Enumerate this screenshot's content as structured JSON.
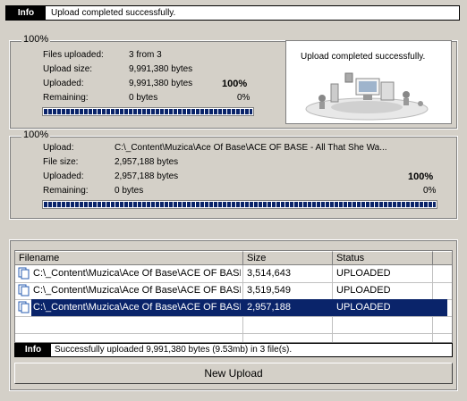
{
  "top_info": {
    "tag": "Info",
    "message": "Upload completed successfully."
  },
  "total_group": {
    "title": "100%",
    "files_uploaded_label": "Files uploaded:",
    "files_uploaded_value": "3 from 3",
    "upload_size_label": "Upload size:",
    "upload_size_value": "9,991,380 bytes",
    "uploaded_label": "Uploaded:",
    "uploaded_value": "9,991,380 bytes",
    "percent": "100%",
    "remaining_label": "Remaining:",
    "remaining_value": "0 bytes",
    "remaining_percent": "0%",
    "progress": 1.0
  },
  "status_panel": {
    "message": "Upload completed successfully."
  },
  "file_group": {
    "title": "100%",
    "upload_label": "Upload:",
    "upload_value": "C:\\_Content\\Muzica\\Ace Of Base\\ACE OF BASE - All That She Wa...",
    "file_size_label": "File size:",
    "file_size_value": "2,957,188 bytes",
    "uploaded_label": "Uploaded:",
    "uploaded_value": "2,957,188 bytes",
    "percent": "100%",
    "remaining_label": "Remaining:",
    "remaining_value": "0 bytes",
    "remaining_percent": "0%",
    "progress": 1.0
  },
  "table": {
    "columns": [
      "Filename",
      "Size",
      "Status"
    ],
    "rows": [
      {
        "filename": "C:\\_Content\\Muzica\\Ace Of Base\\ACE OF BASE ...",
        "size": "3,514,643",
        "status": "UPLOADED",
        "selected": false
      },
      {
        "filename": "C:\\_Content\\Muzica\\Ace Of Base\\ACE OF BASE ...",
        "size": "3,519,549",
        "status": "UPLOADED",
        "selected": false
      },
      {
        "filename": "C:\\_Content\\Muzica\\Ace Of Base\\ACE OF BASE ...",
        "size": "2,957,188",
        "status": "UPLOADED",
        "selected": true
      }
    ]
  },
  "bottom_info": {
    "tag": "Info",
    "message": "Successfully uploaded 9,991,380 bytes (9.53mb) in 3 file(s)."
  },
  "new_upload_button": "New Upload",
  "colors": {
    "selection": "#0a246a",
    "progress_fill": "#0a246a",
    "window_bg": "#d4d0c8"
  }
}
